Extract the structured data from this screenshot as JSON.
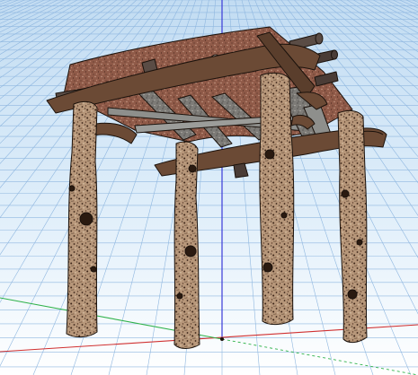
{
  "viewport": {
    "sky_top_color": "#c2dcf2",
    "sky_bottom_color": "#ffffff",
    "grid_color": "#8fb7e0",
    "axes": {
      "red": "#d03030",
      "green": "#2fb24a",
      "blue": "#3a3ad8"
    }
  },
  "model": {
    "kind": "rustic log pergola",
    "wood_dark": "#6b4a35",
    "bark_base": "#b7977a",
    "bark_speckle": "#3b2417",
    "roof_base": "#8f5a48",
    "rafter_grey": "#8e8f8c"
  }
}
